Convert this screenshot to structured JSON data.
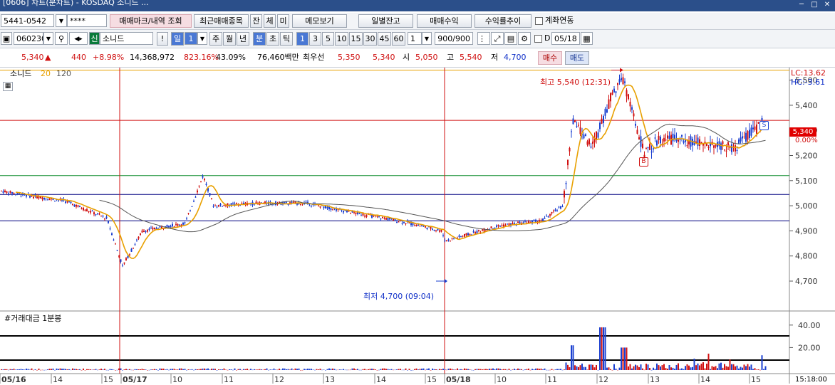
{
  "title": "[0606] 차트(분차트) - KOSDAQ 소니드 ...",
  "title_window_buttons": [
    "─",
    "□",
    "✕"
  ],
  "toolbar1": {
    "account": "5441-0542",
    "password": "****",
    "buttons": [
      "매매마크/내역 조회",
      "최근매매종목",
      "잔",
      "체",
      "미",
      "메모보기",
      "일별잔고",
      "매매수익",
      "수익률추이"
    ],
    "checkbox_label": "계좌연동"
  },
  "toolbar2": {
    "code": "060230",
    "credit_badge": "신",
    "stock_name": "소니드",
    "excl": "!",
    "period_buttons": [
      "일",
      "주",
      "월",
      "년",
      "분",
      "초",
      "틱"
    ],
    "period_value": "1",
    "interval_buttons": [
      "1",
      "3",
      "5",
      "10",
      "15",
      "30",
      "45",
      "60"
    ],
    "interval_input": "1",
    "count": "900/900",
    "date_prefix": "D",
    "date": "05/18"
  },
  "quote": {
    "price": "5,340",
    "arrow": "▲",
    "change": "440",
    "rate": "+8.98%",
    "volume": "14,368,972",
    "vol_ratio": "823.16%",
    "turnover": "43.09%",
    "amount": "76,460백만",
    "best_label": "최우선",
    "best_ask": "5,350",
    "best_bid": "5,340",
    "open_label": "시",
    "open": "5,050",
    "high_label": "고",
    "high": "5,540",
    "low_label": "저",
    "low": "4,700",
    "buy_label": "매수",
    "sell_label": "매도"
  },
  "chart_legend": {
    "name": "소니드",
    "ma1": "20",
    "ma2": "120"
  },
  "lc_label": "LC:13.62",
  "hc_label": "HC:-3.61",
  "price_ticks": [
    "5,500",
    "5,400",
    "5,300",
    "5,200",
    "5,100",
    "5,000",
    "4,900",
    "4,800",
    "4,700"
  ],
  "current_price_box": "5,340",
  "current_pct": "0.00%",
  "max_annotation": "최고 5,540 (12:31)",
  "min_annotation": "최저 4,700 (09:04)",
  "volume_title": "#거래대금 1분봉",
  "volume_ticks": [
    "40.00",
    "20.00"
  ],
  "x_labels": [
    "05/16",
    "14",
    "15",
    "05/17",
    "10",
    "11",
    "12",
    "13",
    "14",
    "15",
    "05/18",
    "10",
    "11",
    "12",
    "13",
    "14",
    "15"
  ],
  "last_time": "15:18:00",
  "marker_b": "B",
  "marker_s": "S",
  "chart_data": {
    "type": "candlestick",
    "title": "소니드",
    "series": [
      {
        "name": "소니드",
        "kind": "price"
      },
      {
        "name": "20",
        "kind": "moving-average",
        "color": "#e8a000"
      },
      {
        "name": "120",
        "kind": "moving-average",
        "color": "#555555"
      }
    ],
    "ylim": [
      4670,
      5580
    ],
    "y_ticks": [
      4700,
      4800,
      4900,
      5000,
      5100,
      5200,
      5300,
      5400,
      5500
    ],
    "last_price": 5340,
    "high": 5540,
    "low": 4700,
    "hlines": [
      5540,
      5340,
      5120,
      5045,
      4940
    ],
    "volume_ylim": [
      0,
      45
    ],
    "volume_ticks": [
      20,
      40
    ],
    "colors": {
      "up": "#d01010",
      "down": "#1a3fd0",
      "ma20": "#e8a000",
      "ma120": "#555555"
    }
  }
}
